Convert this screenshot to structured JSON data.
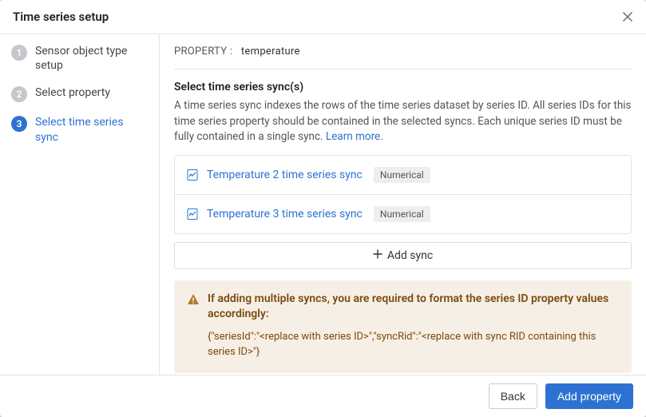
{
  "modal": {
    "title": "Time series setup"
  },
  "steps": [
    {
      "num": "1",
      "label": "Sensor object type setup"
    },
    {
      "num": "2",
      "label": "Select property"
    },
    {
      "num": "3",
      "label": "Select time series sync"
    }
  ],
  "property": {
    "key": "PROPERTY :",
    "value": "temperature"
  },
  "section": {
    "title": "Select time series sync(s)",
    "desc": "A time series sync indexes the rows of the time series dataset by series ID. All series IDs for this time series property should be contained in the selected syncs. Each unique series ID must be fully contained in a single sync. ",
    "learn_more": "Learn more."
  },
  "syncs": [
    {
      "name": "Temperature 2 time series sync",
      "badge": "Numerical"
    },
    {
      "name": "Temperature 3 time series sync",
      "badge": "Numerical"
    }
  ],
  "add_sync_label": "Add sync",
  "warning": {
    "head": "If adding multiple syncs, you are required to format the series ID property values accordingly:",
    "code": "{\"seriesId\":\"<replace with series ID>\",\"syncRid\":\"<replace with sync RID containing this series ID>\"}"
  },
  "footer": {
    "back": "Back",
    "add_property": "Add property"
  }
}
